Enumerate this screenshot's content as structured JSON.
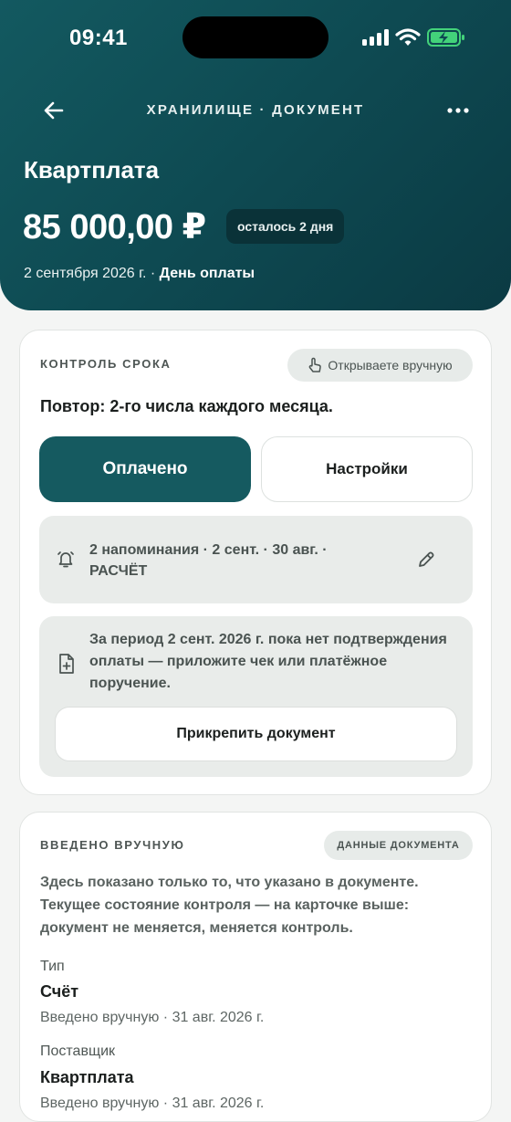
{
  "status_bar": {
    "time": "09:41"
  },
  "nav": {
    "title": "ХРАНИЛИЩЕ · ДОКУМЕНТ"
  },
  "document": {
    "title": "Квартплата",
    "amount": "85 000,00 ₽",
    "days_left": "осталось 2 дня",
    "due_date": "2 сентября 2026 г.",
    "due_separator": " · ",
    "due_label": "День оплаты"
  },
  "control_card": {
    "eyebrow": "КОНТРОЛЬ СРОКА",
    "manual_pill": "Открываете вручную",
    "repeat": "Повтор: 2-го числа каждого месяца.",
    "paid_button": "Оплачено",
    "settings_button": "Настройки",
    "reminders_line1": "2 напоминания · 2 сент. · 30 авг. ·",
    "reminders_line2": "РАСЧЁТ",
    "attach_text": "За период 2 сент. 2026 г. пока нет подтверждения оплаты — приложите чек или платёжное поручение.",
    "attach_button": "Прикрепить документ"
  },
  "manual_card": {
    "eyebrow": "ВВЕДЕНО ВРУЧНУЮ",
    "doc_data_pill": "ДАННЫЕ ДОКУМЕНТА",
    "info": "Здесь показано только то, что указано в документе. Текущее состояние контроля — на карточке выше: документ не меняется, меняется контроль.",
    "fields": [
      {
        "label": "Тип",
        "value": "Счёт",
        "meta": "Введено вручную · 31 авг. 2026 г."
      },
      {
        "label": "Поставщик",
        "value": "Квартплата",
        "meta": "Введено вручную · 31 авг. 2026 г."
      }
    ]
  },
  "colors": {
    "header_primary": "#135960",
    "accent": "#155a60",
    "badge_bg": "#0a3238",
    "battery": "#43d27a"
  }
}
